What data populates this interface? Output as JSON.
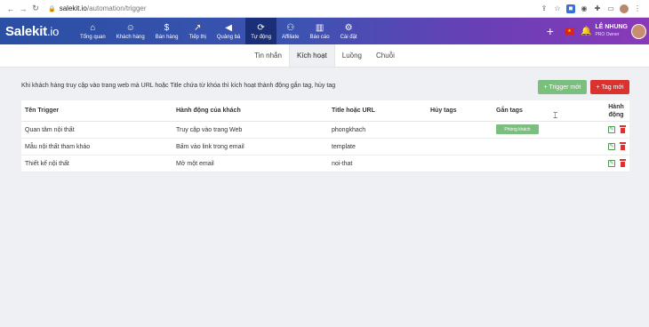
{
  "browser": {
    "url_domain": "salekit.io",
    "url_path": "/automation/trigger"
  },
  "header": {
    "logo_main": "Salekit",
    "logo_suffix": ".io",
    "nav": [
      {
        "label": "Tổng quan",
        "icon": "home-icon"
      },
      {
        "label": "Khách hàng",
        "icon": "users-icon"
      },
      {
        "label": "Bán hàng",
        "icon": "dollar-icon"
      },
      {
        "label": "Tiếp thị",
        "icon": "chart-line-icon"
      },
      {
        "label": "Quảng bá",
        "icon": "megaphone-icon"
      },
      {
        "label": "Tự động",
        "icon": "sync-icon"
      },
      {
        "label": "Affiliate",
        "icon": "network-icon"
      },
      {
        "label": "Báo cáo",
        "icon": "bar-chart-icon"
      },
      {
        "label": "Cài đặt",
        "icon": "gear-icon"
      }
    ],
    "user_name": "LÊ NHUNG",
    "user_role": "PRO Owner"
  },
  "subtabs": [
    "Tin nhắn",
    "Kích hoạt",
    "Luồng",
    "Chuỗi"
  ],
  "active_subtab": "Kích hoạt",
  "description": "Khi khách hàng truy cập vào trang web mà URL hoặc Title chứa từ khóa thì kích hoạt thành động gắn tag, hủy tag",
  "buttons": {
    "trigger_new": "+ Trigger mới",
    "tag_new": "+ Tag mới"
  },
  "table": {
    "headers": {
      "name": "Tên Trigger",
      "action": "Hành động của khách",
      "title": "Title hoặc URL",
      "remove_tags": "Hủy tags",
      "add_tags": "Gắn tags",
      "actions": "Hành động"
    },
    "rows": [
      {
        "name": "Quan tâm nội thất",
        "action": "Truy cập vào trang Web",
        "title": "phongkhach",
        "remove_tags": "",
        "add_tags": "Phòng khách"
      },
      {
        "name": "Mẫu nội thất tham khảo",
        "action": "Bấm vào link trong email",
        "title": "template",
        "remove_tags": "",
        "add_tags": ""
      },
      {
        "name": "Thiết kế nội thất",
        "action": "Mở một email",
        "title": "noi-that",
        "remove_tags": "",
        "add_tags": ""
      }
    ]
  },
  "colors": {
    "header_start": "#2a4fa4",
    "header_end": "#8a39b8",
    "green": "#7bbf7f",
    "red": "#d9322f"
  }
}
